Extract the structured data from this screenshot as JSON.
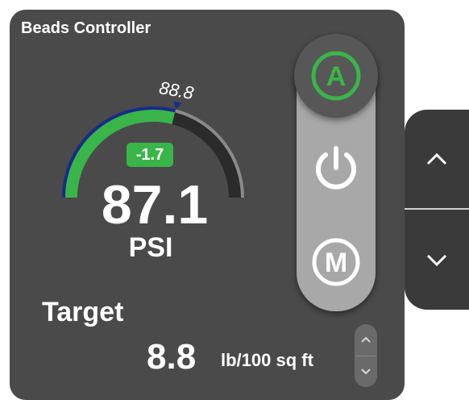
{
  "window": {
    "title": "Beads Controller"
  },
  "gauge": {
    "setpoint": "88.8",
    "deviation": "-1.7",
    "value": "87.1",
    "unit": "PSI",
    "fill_fraction": 0.58,
    "colors": {
      "fill": "#39b54a",
      "range_low": "#1a2a8c",
      "track": "#2b2b2b",
      "outer_track": "#8a8a8a"
    }
  },
  "target": {
    "label": "Target",
    "value": "8.8",
    "unit": "lb/100 sq ft"
  },
  "mode_buttons": {
    "auto_icon": "auto-mode-icon",
    "auto_letter": "A",
    "power_icon": "power-icon",
    "manual_icon": "manual-mode-icon",
    "manual_letter": "M",
    "active_color": "#39b54a"
  },
  "side_stepper": {
    "up_icon": "chevron-up-icon",
    "down_icon": "chevron-down-icon"
  },
  "mini_stepper": {
    "up_icon": "chevron-up-icon",
    "down_icon": "chevron-down-icon"
  }
}
